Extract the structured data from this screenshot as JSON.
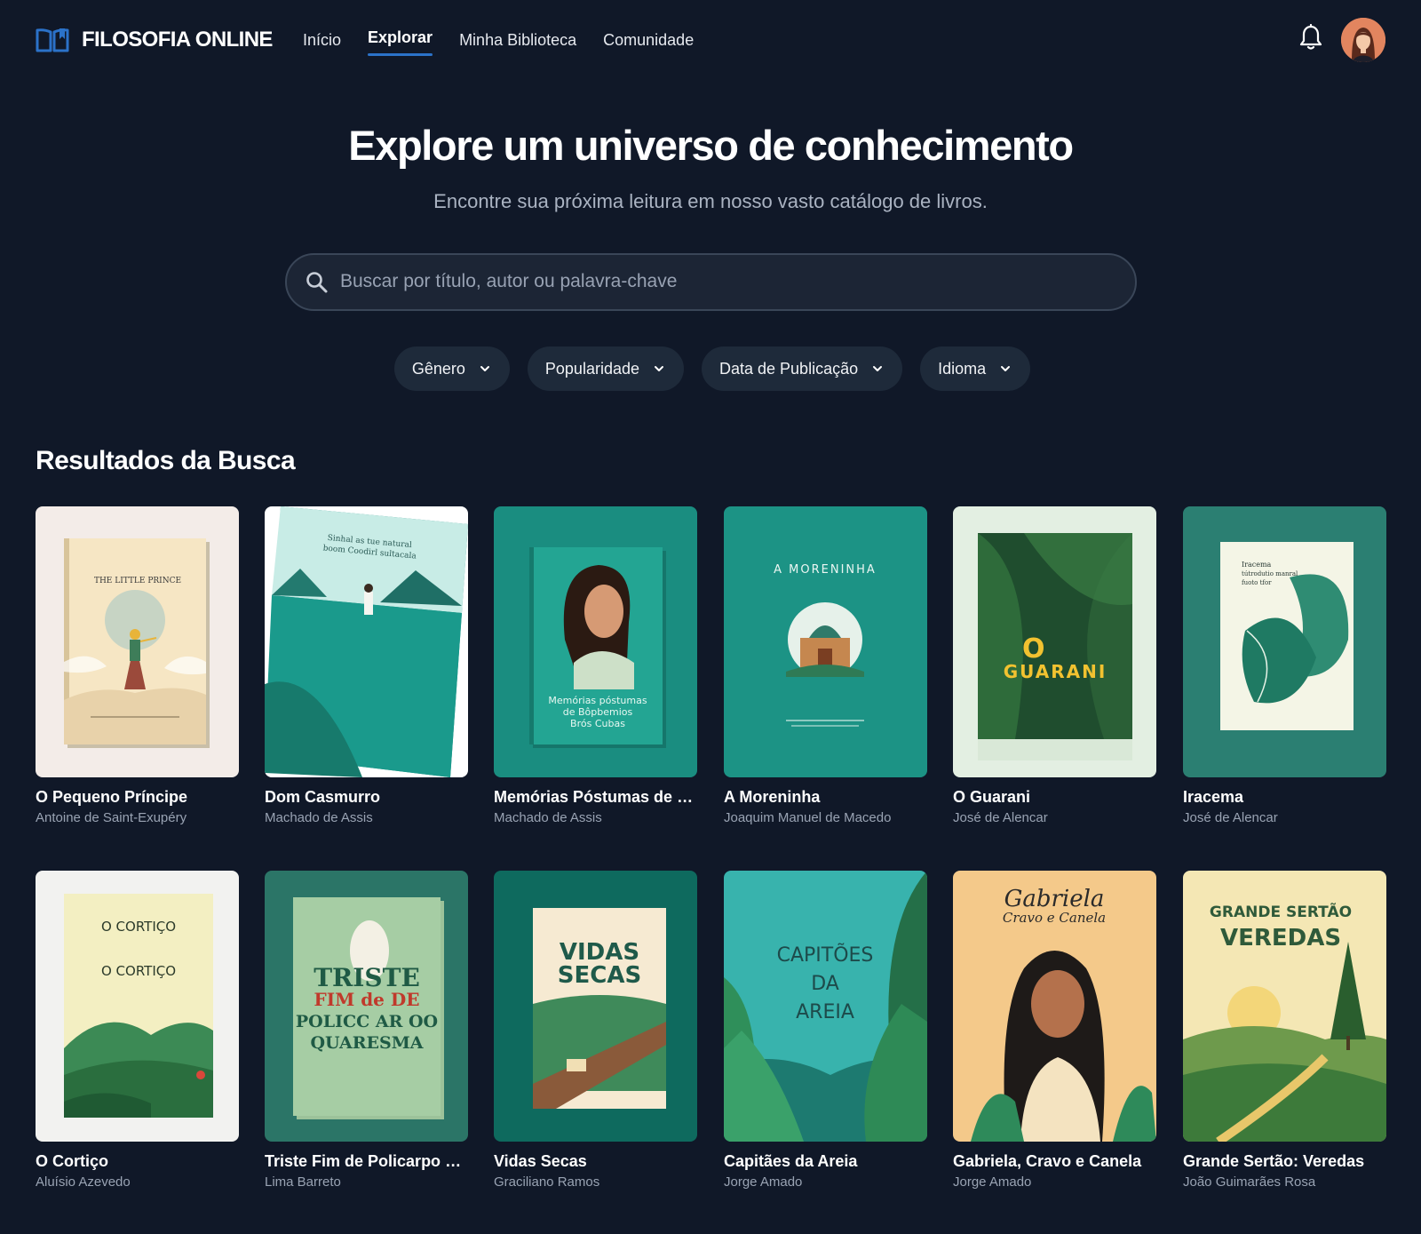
{
  "app": {
    "brand": "FILOSOFIA ONLINE",
    "nav": [
      {
        "label": "Início",
        "active": false
      },
      {
        "label": "Explorar",
        "active": true
      },
      {
        "label": "Minha Biblioteca",
        "active": false
      },
      {
        "label": "Comunidade",
        "active": false
      }
    ]
  },
  "hero": {
    "title": "Explore um universo de conhecimento",
    "subtitle": "Encontre sua próxima leitura em nosso vasto catálogo de livros.",
    "search_placeholder": "Buscar por título, autor ou palavra-chave"
  },
  "filters": [
    {
      "label": "Gênero"
    },
    {
      "label": "Popularidade"
    },
    {
      "label": "Data de Publicação"
    },
    {
      "label": "Idioma"
    }
  ],
  "results": {
    "heading": "Resultados da Busca",
    "books": [
      {
        "title": "O Pequeno Príncipe",
        "author": "Antoine de Saint-Exupéry",
        "cover_text": [
          "THE LITTLE PRINCE"
        ],
        "cover_style": "little-prince"
      },
      {
        "title": "Dom Casmurro",
        "author": "Machado de Assis",
        "cover_text": [
          "Sinhal as tue natural",
          "boom Coodirl sultacala"
        ],
        "cover_style": "sea"
      },
      {
        "title": "Memórias Póstumas de Brás Cubas",
        "author": "Machado de Assis",
        "cover_text": [
          "Memórias póstumas",
          "de Bôpbemios",
          "Brós Cubas"
        ],
        "cover_style": "portrait"
      },
      {
        "title": "A Moreninha",
        "author": "Joaquim Manuel de Macedo",
        "cover_text": [
          "A MORENINHA"
        ],
        "cover_style": "temple"
      },
      {
        "title": "O Guarani",
        "author": "José de Alencar",
        "cover_text": [
          "O",
          "GUARANI"
        ],
        "cover_style": "jungle"
      },
      {
        "title": "Iracema",
        "author": "José de Alencar",
        "cover_text": [
          "Iracema",
          "tútrodutio manral",
          "fuoto tfor"
        ],
        "cover_style": "leaves"
      },
      {
        "title": "O Cortiço",
        "author": "Aluísio Azevedo",
        "cover_text": [
          "O CORTIÇO",
          "O CORTIÇO"
        ],
        "cover_style": "hills"
      },
      {
        "title": "Triste Fim de Policarpo Quaresma",
        "author": "Lima Barreto",
        "cover_text": [
          "TRISTE",
          "FIM de DE",
          "POLICC AR OO",
          "QUARESMA"
        ],
        "cover_style": "triste"
      },
      {
        "title": "Vidas Secas",
        "author": "Graciliano Ramos",
        "cover_text": [
          "VIDAS",
          "SECAS"
        ],
        "cover_style": "road"
      },
      {
        "title": "Capitães da Areia",
        "author": "Jorge Amado",
        "cover_text": [
          "CAPITÕES",
          "DA",
          "AREIA"
        ],
        "cover_style": "capitaes"
      },
      {
        "title": "Gabriela, Cravo e Canela",
        "author": "Jorge Amado",
        "cover_text": [
          "Gabriela",
          "Cravo e Canela"
        ],
        "cover_style": "gabriela"
      },
      {
        "title": "Grande Sertão: Veredas",
        "author": "João Guimarães Rosa",
        "cover_text": [
          "GRANDE SERTÃO",
          "VEREDAS"
        ],
        "cover_style": "sertao"
      }
    ]
  },
  "colors": {
    "background": "#101828",
    "accent": "#2b72c9",
    "pill": "#1e2a3a",
    "muted_text": "#99a3b3"
  }
}
